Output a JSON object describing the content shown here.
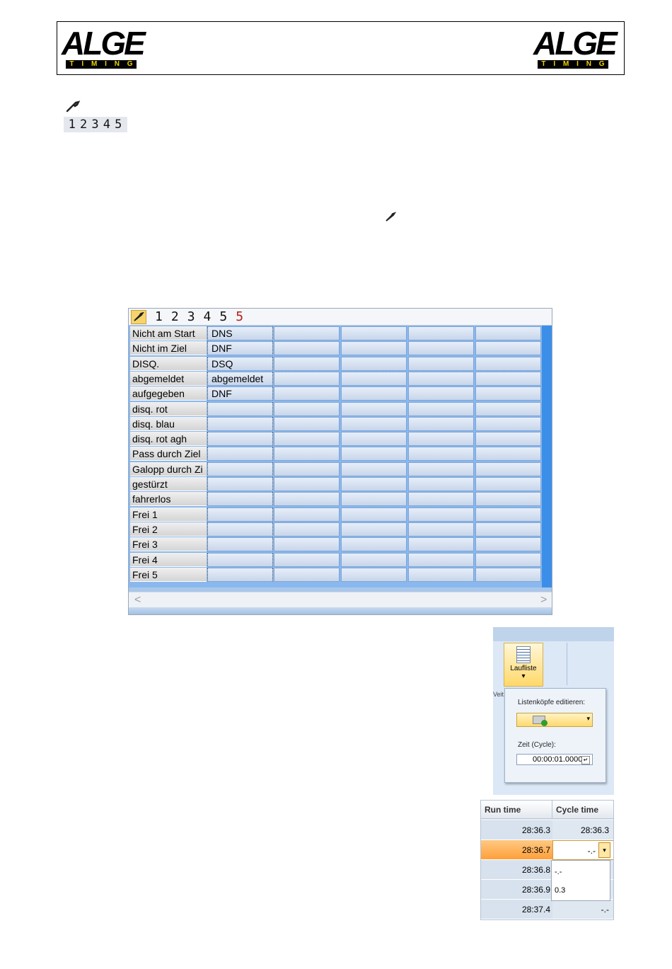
{
  "header": {
    "logo_left": {
      "word": "ALGE",
      "sub": [
        "T",
        "I",
        "M",
        "I",
        "N",
        "G"
      ]
    },
    "logo_right": {
      "word": "ALGE",
      "sub": [
        "T",
        "I",
        "M",
        "I",
        "N",
        "G"
      ]
    }
  },
  "icons": {
    "settings": "wrench-icon"
  },
  "number_strip": [
    "1",
    "2",
    "3",
    "4",
    "5"
  ],
  "grid": {
    "toolbar_numbers": [
      "1",
      "2",
      "3",
      "4",
      "5",
      "5"
    ],
    "rows": [
      {
        "label": "Nicht am Start",
        "value": "DNS"
      },
      {
        "label": "Nicht im Ziel",
        "value": "DNF"
      },
      {
        "label": "DISQ.",
        "value": "DSQ"
      },
      {
        "label": "abgemeldet",
        "value": "abgemeldet"
      },
      {
        "label": "aufgegeben",
        "value": "DNF"
      },
      {
        "label": "disq. rot",
        "value": ""
      },
      {
        "label": "disq. blau",
        "value": ""
      },
      {
        "label": "disq. rot agh",
        "value": ""
      },
      {
        "label": "Pass durch Ziel",
        "value": ""
      },
      {
        "label": "Galopp durch Zi",
        "value": ""
      },
      {
        "label": "gestürzt",
        "value": ""
      },
      {
        "label": "fahrerlos",
        "value": ""
      },
      {
        "label": "Frei 1",
        "value": ""
      },
      {
        "label": "Frei 2",
        "value": ""
      },
      {
        "label": "Frei 3",
        "value": ""
      },
      {
        "label": "Frei 4",
        "value": ""
      },
      {
        "label": "Frei 5",
        "value": ""
      }
    ],
    "scroll_left": "<",
    "scroll_right": ">"
  },
  "ribbon": {
    "button_label": "Laufliste",
    "button_arrow": "▾",
    "side_text": "Veit",
    "list_heads_label": "Listenköpfe editieren:",
    "time_label": "Zeit (Cycle):",
    "time_value": "00:00:01.0000"
  },
  "times": {
    "headers": [
      "Run time",
      "Cycle time"
    ],
    "rows": [
      {
        "run": "28:36.3",
        "cycle": "28:36.3"
      },
      {
        "run": "28:36.7",
        "cycle": "-.-"
      },
      {
        "run": "28:36.8",
        "cycle": ""
      },
      {
        "run": "28:36.9",
        "cycle": ""
      },
      {
        "run": "28:37.4",
        "cycle": "-.-"
      }
    ],
    "dropdown_options": [
      "-.-",
      "0.3"
    ]
  }
}
